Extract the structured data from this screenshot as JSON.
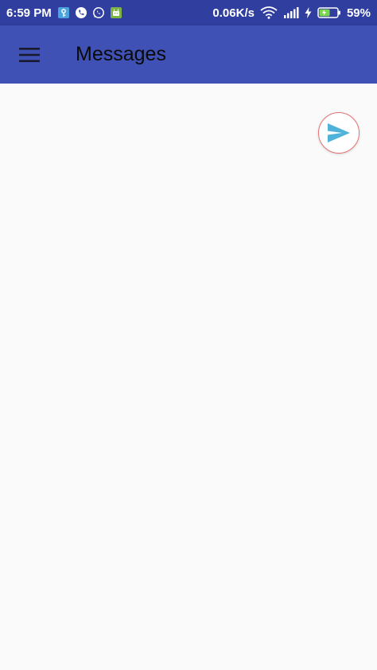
{
  "status_bar": {
    "time": "6:59 PM",
    "notification_icons": [
      "vpn-key-icon",
      "phone-call-icon",
      "whatsapp-icon",
      "android-icon"
    ],
    "network_speed": "0.06K/s",
    "battery_percent": "59%",
    "battery_level": 0.59
  },
  "app_bar": {
    "title": "Messages",
    "menu_icon": "hamburger-menu-icon"
  },
  "fab": {
    "icon": "send-icon",
    "icon_color": "#4fb3d9",
    "border_color": "#e57373"
  },
  "colors": {
    "status_bar": "#303f9f",
    "app_bar": "#3f51b5",
    "background": "#fafafa"
  }
}
